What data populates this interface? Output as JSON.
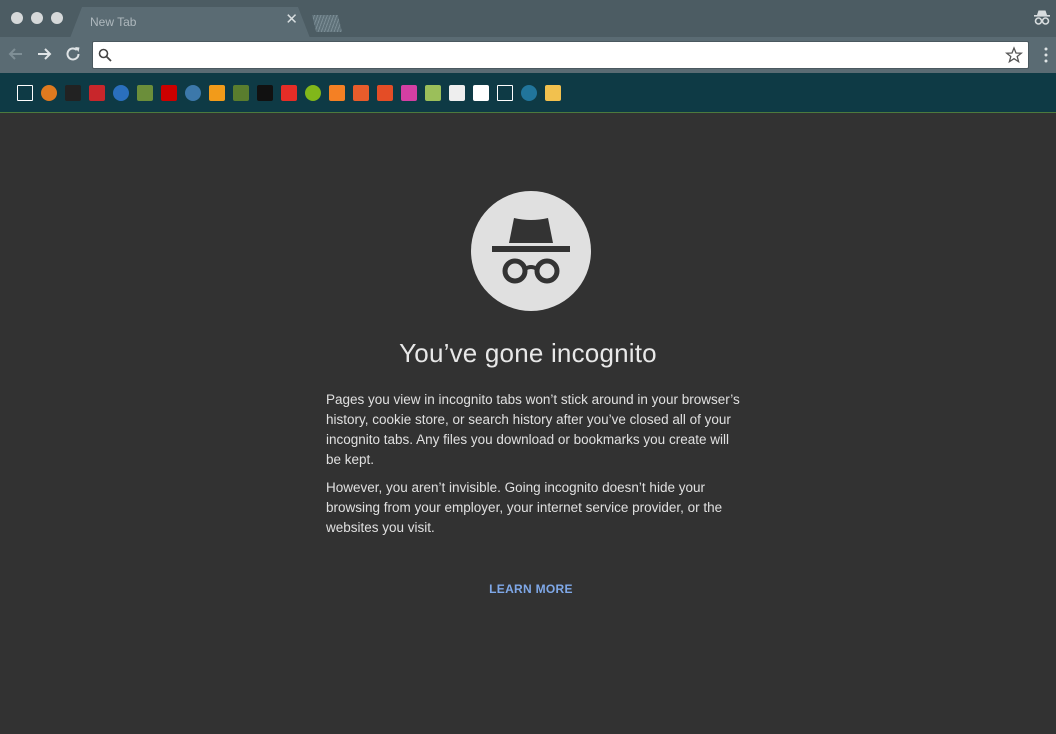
{
  "tab": {
    "title": "New Tab",
    "close_glyph": "✕"
  },
  "omnibox": {
    "value": "",
    "placeholder": ""
  },
  "bookmarks": [
    {
      "icon": "folder-icon",
      "color": "#ffffff"
    },
    {
      "icon": "basketball-icon",
      "color": "#e07a1f"
    },
    {
      "icon": "ninja-icon",
      "color": "#222222"
    },
    {
      "icon": "s-logo-icon",
      "color": "#c8262b"
    },
    {
      "icon": "info-icon",
      "color": "#2a6fbd"
    },
    {
      "icon": "minecraft-block-icon",
      "color": "#6b8e3a"
    },
    {
      "icon": "rh-logo-icon",
      "color": "#cc0000"
    },
    {
      "icon": "python-icon",
      "color": "#3c78aa"
    },
    {
      "icon": "asterisk-icon",
      "color": "#f29b1a"
    },
    {
      "icon": "minecraft-block-icon",
      "color": "#5a7d2e"
    },
    {
      "icon": "terminal-icon",
      "color": "#111111"
    },
    {
      "icon": "youtube-icon",
      "color": "#e52d27"
    },
    {
      "icon": "spotify-icon",
      "color": "#81b71a"
    },
    {
      "icon": "stackoverflow-icon",
      "color": "#f48024"
    },
    {
      "icon": "first-aid-icon",
      "color": "#e85c2b"
    },
    {
      "icon": "html5-icon",
      "color": "#e44d26"
    },
    {
      "icon": "ampersand-icon",
      "color": "#d43fa3"
    },
    {
      "icon": "picture-icon",
      "color": "#9bbf5a"
    },
    {
      "icon": "face-icon",
      "color": "#eeeeee"
    },
    {
      "icon": "quill-icon",
      "color": "#ffffff"
    },
    {
      "icon": "document-icon",
      "color": "#ffffff"
    },
    {
      "icon": "wordpress-icon",
      "color": "#21759b"
    },
    {
      "icon": "thumbs-up-icon",
      "color": "#f2c14e"
    }
  ],
  "content": {
    "heading": "You’ve gone incognito",
    "paragraph1": "Pages you view in incognito tabs won’t stick around in your browser’s history, cookie store, or search history after you’ve closed all of your incognito tabs. Any files you download or bookmarks you create will be kept.",
    "paragraph2": "However, you aren’t invisible. Going incognito doesn’t hide your browsing from your employer, your internet service provider, or the websites you visit.",
    "learn_more": "LEARN MORE"
  },
  "colors": {
    "titlebar": "#4c5c63",
    "toolbar": "#5a6b73",
    "bookmarks_bar": "#0e3a45",
    "page_bg": "#323232",
    "link": "#7fa8e8"
  }
}
